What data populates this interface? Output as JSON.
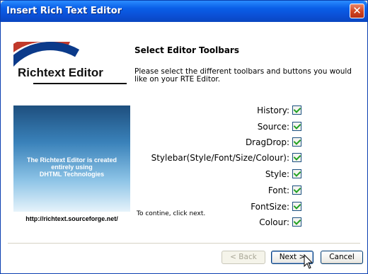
{
  "window": {
    "title": "Insert Rich Text Editor",
    "close_glyph": "✕"
  },
  "banner": {
    "logo_text": "Richtext Editor",
    "description_lines": [
      "The Richtext Editor is created",
      "entirely using",
      "DHTML Technologies"
    ],
    "url": "http://richtext.sourceforge.net/"
  },
  "main": {
    "heading": "Select Editor Toolbars",
    "description": "Please select the different toolbars and buttons you would like on your RTE Editor.",
    "options": [
      {
        "label": "History:",
        "checked": true
      },
      {
        "label": "Source:",
        "checked": true
      },
      {
        "label": "DragDrop:",
        "checked": true
      },
      {
        "label": "Stylebar(Style/Font/Size/Colour):",
        "checked": true
      },
      {
        "label": "Style:",
        "checked": true
      },
      {
        "label": "Font:",
        "checked": true
      },
      {
        "label": "FontSize:",
        "checked": true
      },
      {
        "label": "Colour:",
        "checked": true
      }
    ],
    "hint": "To contine, click next."
  },
  "buttons": {
    "back": "< Back",
    "next": "Next >",
    "cancel": "Cancel"
  },
  "icons": {
    "close": "close-icon",
    "cursor": "pointer-cursor-icon"
  },
  "colors": {
    "titlebar": "#0a5fe8",
    "check": "#21a121",
    "banner": "#3a82ba"
  }
}
